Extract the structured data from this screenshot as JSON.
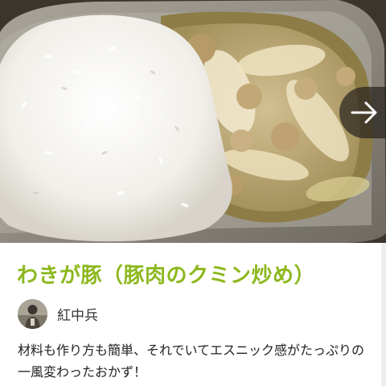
{
  "recipe": {
    "title": "わきが豚（豚肉のクミン炒め）",
    "author_name": "紅中兵",
    "description": "材料も作り方も簡単、それでいてエスニック感がたっぷりの一風変わったおかず！"
  },
  "photo": {
    "next_arrow_icon": "arrow-right-icon"
  },
  "colors": {
    "title": "#8cb81e",
    "arrow_bg": "#28241e"
  }
}
